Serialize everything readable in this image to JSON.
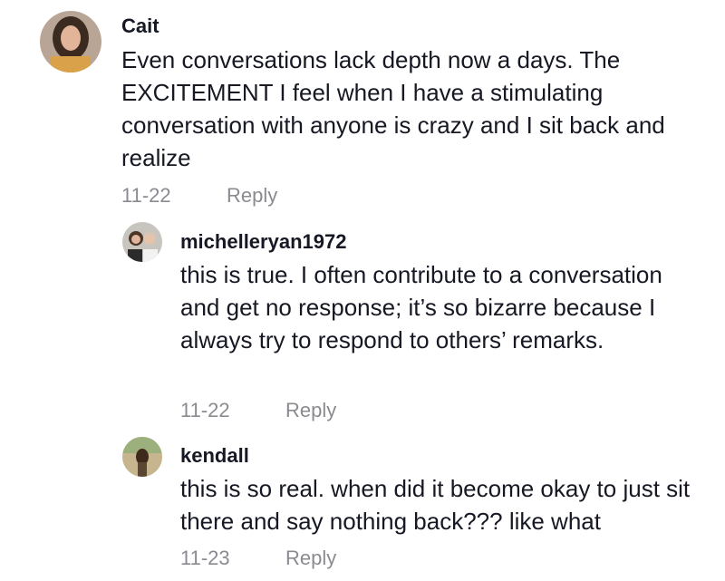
{
  "comments": [
    {
      "username": "Cait",
      "text": "Even conversations lack depth now a days. The EXCITEMENT I feel when I have a stimulating conversation with anyone is crazy and I sit back and realize",
      "date": "11-22",
      "reply_label": "Reply"
    },
    {
      "username": "michelleryan1972",
      "text": "this is true. I often contribute to a conversation and get no response; it’s so bizarre because I always try to respond to others’ remarks.",
      "date": "11-22",
      "reply_label": "Reply"
    },
    {
      "username": "kendall",
      "text": "this is so real. when did it become okay to just sit there and say nothing back??? like what",
      "date": "11-23",
      "reply_label": "Reply"
    }
  ],
  "colors": {
    "text": "#161823",
    "meta": "#8a8b91"
  }
}
